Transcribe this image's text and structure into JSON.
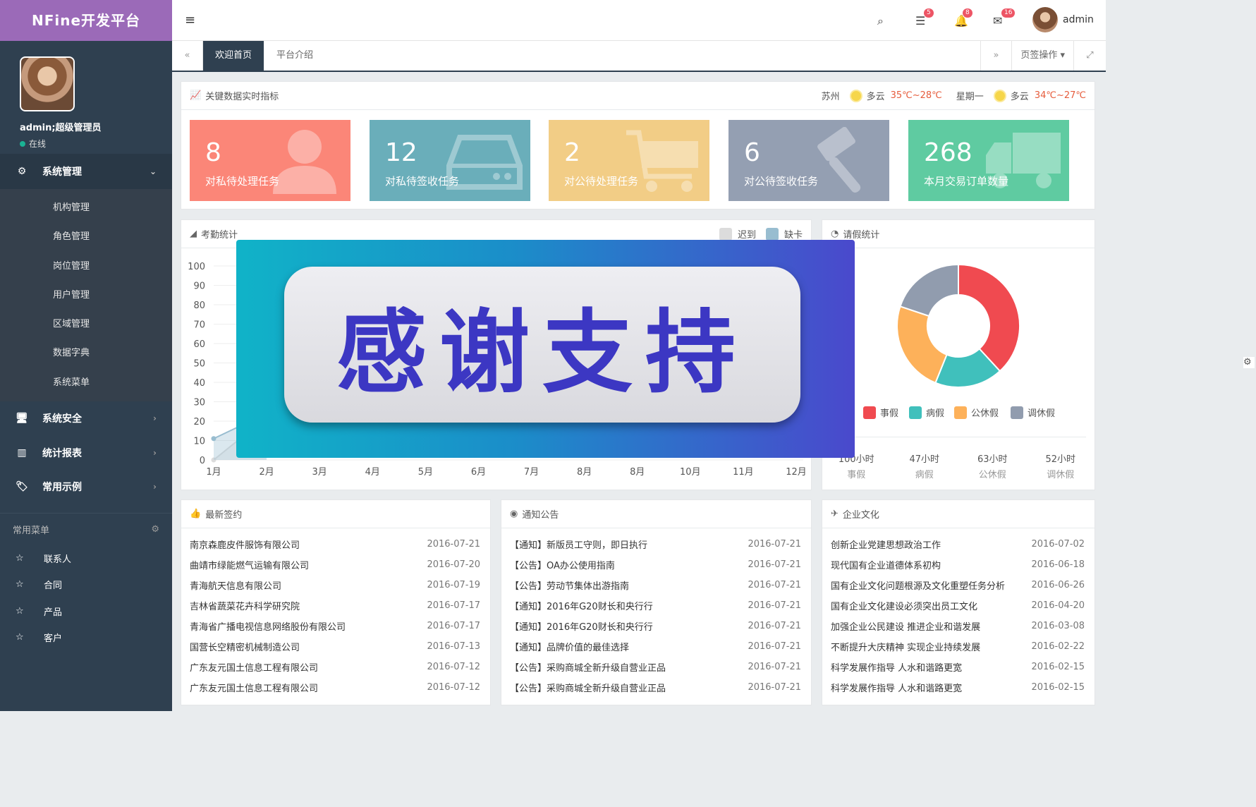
{
  "sidebar": {
    "logo": "NFine开发平台",
    "user_name": "admin;超级管理员",
    "user_status": "在线",
    "system_mgmt": {
      "label": "系统管理",
      "items": [
        "机构管理",
        "角色管理",
        "岗位管理",
        "用户管理",
        "区域管理",
        "数据字典",
        "系统菜单"
      ]
    },
    "sections": [
      "系统安全",
      "统计报表",
      "常用示例"
    ],
    "favorites_title": "常用菜单",
    "favorites": [
      "联系人",
      "合同",
      "产品",
      "客户"
    ]
  },
  "topbar": {
    "badges": {
      "tasks": "5",
      "bell": "8",
      "mail": "16"
    },
    "username": "admin"
  },
  "tabs": {
    "items": [
      "欢迎首页",
      "平台介绍"
    ],
    "active": 0,
    "ops_label": "页签操作"
  },
  "kpi": {
    "title": "关键数据实时指标",
    "weather": {
      "city": "苏州",
      "today_cond": "多云",
      "today_temp": "35℃~28℃",
      "weekday": "星期一",
      "next_cond": "多云",
      "next_temp": "34℃~27℃"
    },
    "cards": [
      {
        "value": "8",
        "label": "对私待处理任务",
        "color": "#fb8678"
      },
      {
        "value": "12",
        "label": "对私待签收任务",
        "color": "#6aaeba"
      },
      {
        "value": "2",
        "label": "对公待处理任务",
        "color": "#f2cd86"
      },
      {
        "value": "6",
        "label": "对公待签收任务",
        "color": "#949fb2"
      },
      {
        "value": "268",
        "label": "本月交易订单数量",
        "color": "#5fcba1"
      }
    ]
  },
  "attendance": {
    "title": "考勤统计",
    "legend": [
      {
        "name": "迟到",
        "color": "#dcdcdc"
      },
      {
        "name": "缺卡",
        "color": "#98bdd0"
      }
    ]
  },
  "leave": {
    "title": "请假统计",
    "summary": [
      {
        "value": "100小时",
        "label": "事假"
      },
      {
        "value": "47小时",
        "label": "病假"
      },
      {
        "value": "63小时",
        "label": "公休假"
      },
      {
        "value": "52小时",
        "label": "调休假"
      }
    ]
  },
  "overlay": {
    "text": "感谢支持"
  },
  "chart_data": [
    {
      "type": "area",
      "title": "考勤统计",
      "categories": [
        "1月",
        "2月",
        "3月",
        "4月",
        "5月",
        "6月",
        "7月",
        "8月",
        "8月",
        "10月",
        "11月",
        "12月"
      ],
      "y_ticks": [
        "100",
        "90",
        "80",
        "70",
        "60",
        "50",
        "40",
        "30",
        "20",
        "10",
        "0"
      ],
      "ylim": [
        0,
        100
      ],
      "grid": true,
      "legend_position": "top-right",
      "series": [
        {
          "name": "迟到",
          "values": [
            0,
            22
          ]
        },
        {
          "name": "缺卡",
          "values": [
            11,
            24
          ]
        }
      ]
    },
    {
      "type": "pie",
      "title": "请假统计",
      "legend_position": "bottom",
      "categories": [
        "事假",
        "病假",
        "公休假",
        "调休假"
      ],
      "values": [
        100,
        47,
        63,
        52
      ],
      "colors": [
        "#f04a50",
        "#40c0bc",
        "#fdb15a",
        "#919cae"
      ]
    }
  ],
  "signings": {
    "title": "最新签约",
    "rows": [
      {
        "name": "南京森鹿皮件服饰有限公司",
        "date": "2016-07-21"
      },
      {
        "name": "曲靖市绿能燃气运输有限公司",
        "date": "2016-07-20"
      },
      {
        "name": "青海航天信息有限公司",
        "date": "2016-07-19"
      },
      {
        "name": "吉林省蔬菜花卉科学研究院",
        "date": "2016-07-17"
      },
      {
        "name": "青海省广播电视信息网络股份有限公司",
        "date": "2016-07-17"
      },
      {
        "name": "国营长空精密机械制造公司",
        "date": "2016-07-13"
      },
      {
        "name": "广东友元国土信息工程有限公司",
        "date": "2016-07-12"
      },
      {
        "name": "广东友元国土信息工程有限公司",
        "date": "2016-07-12"
      }
    ]
  },
  "notices": {
    "title": "通知公告",
    "rows": [
      {
        "name": "【通知】新版员工守则，即日执行",
        "date": "2016-07-21"
      },
      {
        "name": "【公告】OA办公使用指南",
        "date": "2016-07-21"
      },
      {
        "name": "【公告】劳动节集体出游指南",
        "date": "2016-07-21"
      },
      {
        "name": "【通知】2016年G20财长和央行行",
        "date": "2016-07-21"
      },
      {
        "name": "【通知】2016年G20财长和央行行",
        "date": "2016-07-21"
      },
      {
        "name": "【通知】品牌价值的最佳选择",
        "date": "2016-07-21"
      },
      {
        "name": "【公告】采购商城全新升级自营业正品",
        "date": "2016-07-21"
      },
      {
        "name": "【公告】采购商城全新升级自营业正品",
        "date": "2016-07-21"
      }
    ]
  },
  "culture": {
    "title": "企业文化",
    "rows": [
      {
        "name": "创新企业党建思想政治工作",
        "date": "2016-07-02"
      },
      {
        "name": "现代国有企业道德体系初构",
        "date": "2016-06-18"
      },
      {
        "name": "国有企业文化问题根源及文化重塑任务分析",
        "date": "2016-06-26"
      },
      {
        "name": "国有企业文化建设必须突出员工文化",
        "date": "2016-04-20"
      },
      {
        "name": "加强企业公民建设 推进企业和谐发展",
        "date": "2016-03-08"
      },
      {
        "name": "不断提升大庆精神 实现企业持续发展",
        "date": "2016-02-22"
      },
      {
        "name": "科学发展作指导 人水和谐路更宽",
        "date": "2016-02-15"
      },
      {
        "name": "科学发展作指导 人水和谐路更宽",
        "date": "2016-02-15"
      }
    ]
  }
}
